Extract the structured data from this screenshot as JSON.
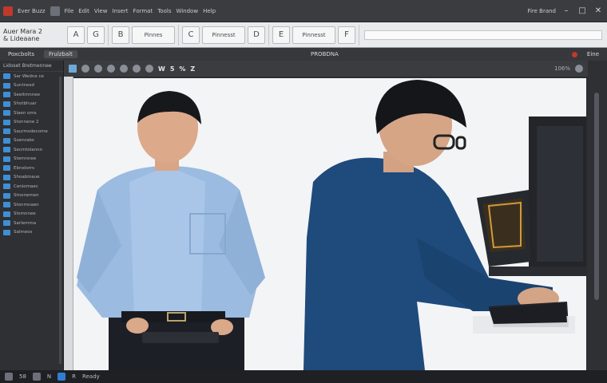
{
  "menubar": {
    "items": [
      "Ever Buzz",
      "File",
      "Edit",
      "View",
      "Insert",
      "Format",
      "Tools",
      "Window",
      "Help"
    ],
    "right_label": "Fire Brand"
  },
  "ribbon": {
    "title": "Auer Mara 2",
    "subtitle": "& Lideaane",
    "buttons": [
      "A",
      "G",
      "B",
      "C",
      "D",
      "E",
      "F"
    ],
    "wide_buttons": [
      "Pinnes",
      "Pinnesst",
      "Pinnesst"
    ]
  },
  "tabs": {
    "left": "Poxcbolts",
    "active": "Frulzbalt",
    "center": "PROBDNA",
    "right": "Eine"
  },
  "leftpanel": {
    "header": "Lidoset Bretmennee",
    "items": [
      "Sar Wedne ce",
      "Suntnesd",
      "Seeitmnnee",
      "Shotbhuar",
      "Slaen oms",
      "Stonnene 2",
      "Saurmsdecome",
      "Soenrabs",
      "Secmtolannn",
      "Stemnnee",
      "Ebnelorrs",
      "Shoabinaue",
      "Ceniomaec",
      "Stnonemen",
      "Stonmnaen",
      "Stsmnnee",
      "Sarlemma",
      "Salmeos"
    ]
  },
  "doctoolbar": {
    "bold": "W",
    "items": [
      "5",
      "%",
      "Z"
    ],
    "zoom": "106%"
  },
  "statusbar": {
    "items": [
      "58",
      "N",
      "R"
    ],
    "status": "Ready"
  },
  "colors": {
    "accent": "#2f7fd1",
    "chrome": "#2b2d30",
    "ribbon": "#e9eaec"
  }
}
